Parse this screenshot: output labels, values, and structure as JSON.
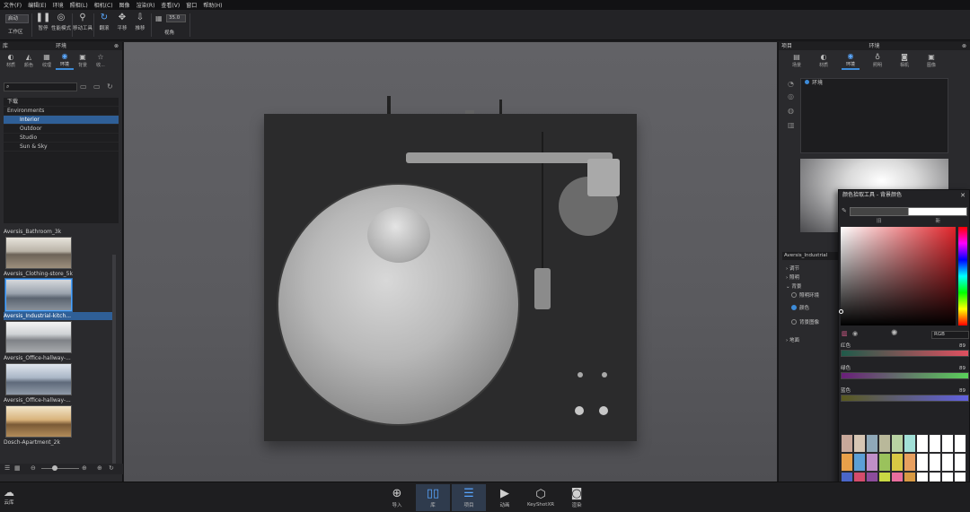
{
  "menu": [
    "文件(F)",
    "编辑(E)",
    "环境",
    "照相(L)",
    "相机(C)",
    "图像",
    "渲染(R)",
    "查看(V)",
    "窗口",
    "帮助(H)"
  ],
  "toolbar": {
    "workspace_select": "启动",
    "workspace_label": "工作区",
    "buttons": [
      {
        "label": "暂停",
        "icon": "pause-icon"
      },
      {
        "label": "性能模式",
        "icon": "performance-icon"
      },
      {
        "label": "移动工具",
        "icon": "move-tool-icon"
      },
      {
        "label": "翻滚",
        "icon": "tumble-icon"
      },
      {
        "label": "平移",
        "icon": "pan-icon"
      },
      {
        "label": "推移",
        "icon": "dolly-icon"
      }
    ],
    "fov_value": "35.0",
    "fov_label": "视角"
  },
  "left_panel": {
    "header": "环境",
    "corner": "库",
    "tabs": [
      "材质",
      "颜色",
      "纹理",
      "环境",
      "背景",
      "收..."
    ],
    "active_tab": 3,
    "tree": [
      {
        "label": "下载",
        "sel": false
      },
      {
        "label": "Environments",
        "sel": false
      },
      {
        "label": "Interior",
        "sel": true
      },
      {
        "label": "Outdoor",
        "sel": false
      },
      {
        "label": "Studio",
        "sel": false
      },
      {
        "label": "Sun & Sky",
        "sel": false
      }
    ],
    "thumbnails": [
      "Aversis_Bathroom_3k",
      "Aversis_Clothing-store_5k",
      "Aversis_Industrial-kitch...",
      "Aversis_Office-hallway-...",
      "Aversis_Office-hallway-...",
      "Dosch-Apartment_2k"
    ],
    "selected_thumb": 2
  },
  "right_panel": {
    "header": "环境",
    "corner": "项目",
    "tabs": [
      "场景",
      "材质",
      "环境",
      "照明",
      "相机",
      "图像"
    ],
    "active_tab": 2,
    "env_item": "环境",
    "env_name": "Aversis_Industrial",
    "sections": [
      "调节",
      "照明",
      "背景"
    ],
    "background_options": [
      {
        "label": "照明环境",
        "on": false
      },
      {
        "label": "颜色",
        "on": true
      },
      {
        "label": "背景图像",
        "on": false
      }
    ],
    "ground": "地面"
  },
  "picker": {
    "title": "颜色拾取工具 - 背景颜色",
    "old_label": "旧",
    "new_label": "新",
    "mode": "RGB",
    "channels": [
      {
        "label": "红色",
        "value": "89"
      },
      {
        "label": "绿色",
        "value": "89"
      },
      {
        "label": "蓝色",
        "value": "89"
      }
    ],
    "swatches": [
      "#c8a89a",
      "#d7c6b4",
      "#8fa8b8",
      "#b9b89a",
      "#b8d2a2",
      "#a2e0d8",
      "#ffffff",
      "#ffffff",
      "#ffffff",
      "#ffffff",
      "#e8a04a",
      "#5c9fd6",
      "#c08fc8",
      "#9ac25c",
      "#d8c844",
      "#e8a060",
      "#ffffff",
      "#ffffff",
      "#ffffff",
      "#ffffff",
      "#4a66c8",
      "#d44c6c",
      "#8c4c9c",
      "#c8d844",
      "#e86e9e",
      "#d89a44",
      "#ffffff",
      "#ffffff",
      "#ffffff",
      "#ffffff",
      "#2c3c98",
      "#5fb07a",
      "#d63a36",
      "#f0d830",
      "#c84aa0",
      "#44b0c0",
      "#ffffff",
      "#ffffff",
      "#ffffff",
      "#ffffff"
    ]
  },
  "bottombar": {
    "left": "云库",
    "buttons": [
      {
        "label": "导入",
        "icon": "import-icon"
      },
      {
        "label": "库",
        "icon": "library-icon"
      },
      {
        "label": "项目",
        "icon": "project-icon"
      },
      {
        "label": "动画",
        "icon": "animation-icon"
      },
      {
        "label": "KeyShotXR",
        "icon": "keyshotxr-icon"
      },
      {
        "label": "渲染",
        "icon": "render-icon"
      }
    ]
  },
  "colors": {
    "accent": "#3d8bd8",
    "selection": "#2f5f97"
  }
}
